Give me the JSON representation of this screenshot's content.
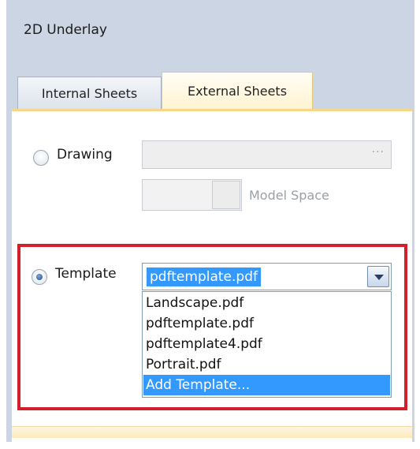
{
  "panel": {
    "title": "2D Underlay"
  },
  "tabs": [
    {
      "label": "Internal Sheets",
      "active": false
    },
    {
      "label": "External Sheets",
      "active": true
    }
  ],
  "drawing": {
    "label": "Drawing",
    "selected": false,
    "path_value": "",
    "browse_label": "···",
    "space_label": "Model Space"
  },
  "template": {
    "label": "Template",
    "selected": true,
    "current_value": "pdftemplate.pdf",
    "options": [
      "Landscape.pdf",
      "pdftemplate.pdf",
      "pdftemplate4.pdf",
      "Portrait.pdf",
      "Add Template..."
    ],
    "highlighted_option_index": 4
  },
  "colors": {
    "accent_blue": "#3399ff",
    "highlight_red": "#d21f2c",
    "panel_bg": "#ccd5e3",
    "active_tab": "#fff3cf"
  }
}
